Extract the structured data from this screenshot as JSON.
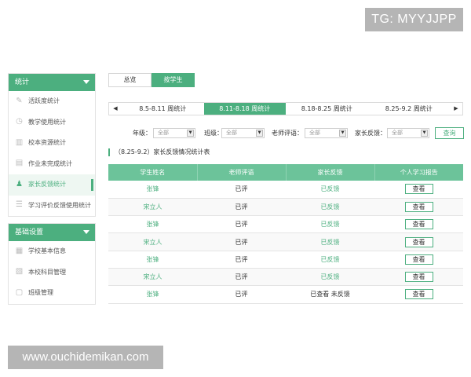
{
  "watermarks": {
    "top": "TG: MYYJJPP",
    "bottom": "www.ouchidemikan.com"
  },
  "sidebar": {
    "groups": [
      {
        "title": "统计",
        "items": [
          {
            "label": "活跃度统计",
            "icon": "pencil-icon"
          },
          {
            "label": "教学使用统计",
            "icon": "clock-icon"
          },
          {
            "label": "校本资源统计",
            "icon": "bar-chart-icon"
          },
          {
            "label": "作业未完成统计",
            "icon": "document-icon"
          },
          {
            "label": "家长反馈统计",
            "icon": "people-icon"
          },
          {
            "label": "学习评价反馈使用统计",
            "icon": "list-icon"
          }
        ]
      },
      {
        "title": "基础设置",
        "items": [
          {
            "label": "学校基本信息",
            "icon": "building-icon"
          },
          {
            "label": "本校科目管理",
            "icon": "book-icon"
          },
          {
            "label": "班级管理",
            "icon": "class-icon"
          }
        ]
      }
    ]
  },
  "top_tabs": [
    "总览",
    "按学生"
  ],
  "week_strip": {
    "prev": "◀",
    "next": "▶",
    "weeks": [
      "8.5-8.11 周统计",
      "8.11-8.18 周统计",
      "8.18-8.25 周统计",
      "8.25-9.2 周统计"
    ]
  },
  "filters": {
    "grade_label": "年级：",
    "grade_value": "全部",
    "class_label": "班级：",
    "class_value": "全部",
    "teacher_label": "老师评语：",
    "teacher_value": "全部",
    "parent_label": "家长反馈：",
    "parent_value": "全部",
    "query": "查询"
  },
  "table": {
    "title": "（8.25-9.2）家长反馈情况统计表",
    "headers": [
      "学生姓名",
      "老师评语",
      "家长反馈",
      "个人学习报告"
    ],
    "rows": [
      {
        "name": "张锋",
        "teacher": "已评",
        "parent": "已反馈",
        "action": "查看"
      },
      {
        "name": "宋立人",
        "teacher": "已评",
        "parent": "已反馈",
        "action": "查看"
      },
      {
        "name": "张锋",
        "teacher": "已评",
        "parent": "已反馈",
        "action": "查看"
      },
      {
        "name": "宋立人",
        "teacher": "已评",
        "parent": "已反馈",
        "action": "查看"
      },
      {
        "name": "张锋",
        "teacher": "已评",
        "parent": "已反馈",
        "action": "查看"
      },
      {
        "name": "宋立人",
        "teacher": "已评",
        "parent": "已反馈",
        "action": "查看"
      },
      {
        "name": "张锋",
        "teacher": "已评",
        "parent": "已查看 未反馈",
        "action": "查看"
      }
    ]
  },
  "colors": {
    "accent": "#4caf7f",
    "header": "#6cc39a"
  }
}
